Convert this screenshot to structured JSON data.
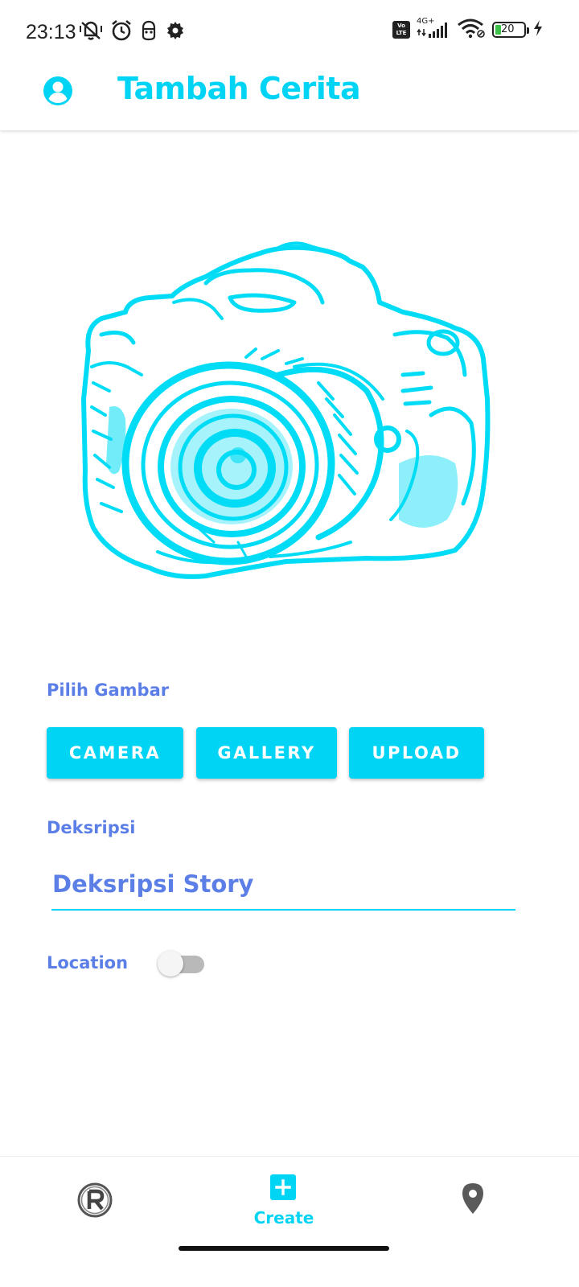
{
  "status_bar": {
    "time": "23:13",
    "network": "4G+",
    "volte": "Vo LTE",
    "battery": "20"
  },
  "app_bar": {
    "title": "Tambah Cerita"
  },
  "form": {
    "image_label": "Pilih Gambar",
    "buttons": {
      "camera": "CAMERA",
      "gallery": "GALLERY",
      "upload": "UPLOAD"
    },
    "description_label": "Deksripsi",
    "description_placeholder": "Deksripsi Story",
    "location_label": "Location",
    "location_enabled": false
  },
  "bottom_nav": {
    "create_label": "Create",
    "home_icon": "r-logo-icon",
    "create_icon": "plus-box-icon",
    "map_icon": "map-pin-icon"
  },
  "colors": {
    "accent": "#00d4f5",
    "label": "#5b7fe6"
  }
}
